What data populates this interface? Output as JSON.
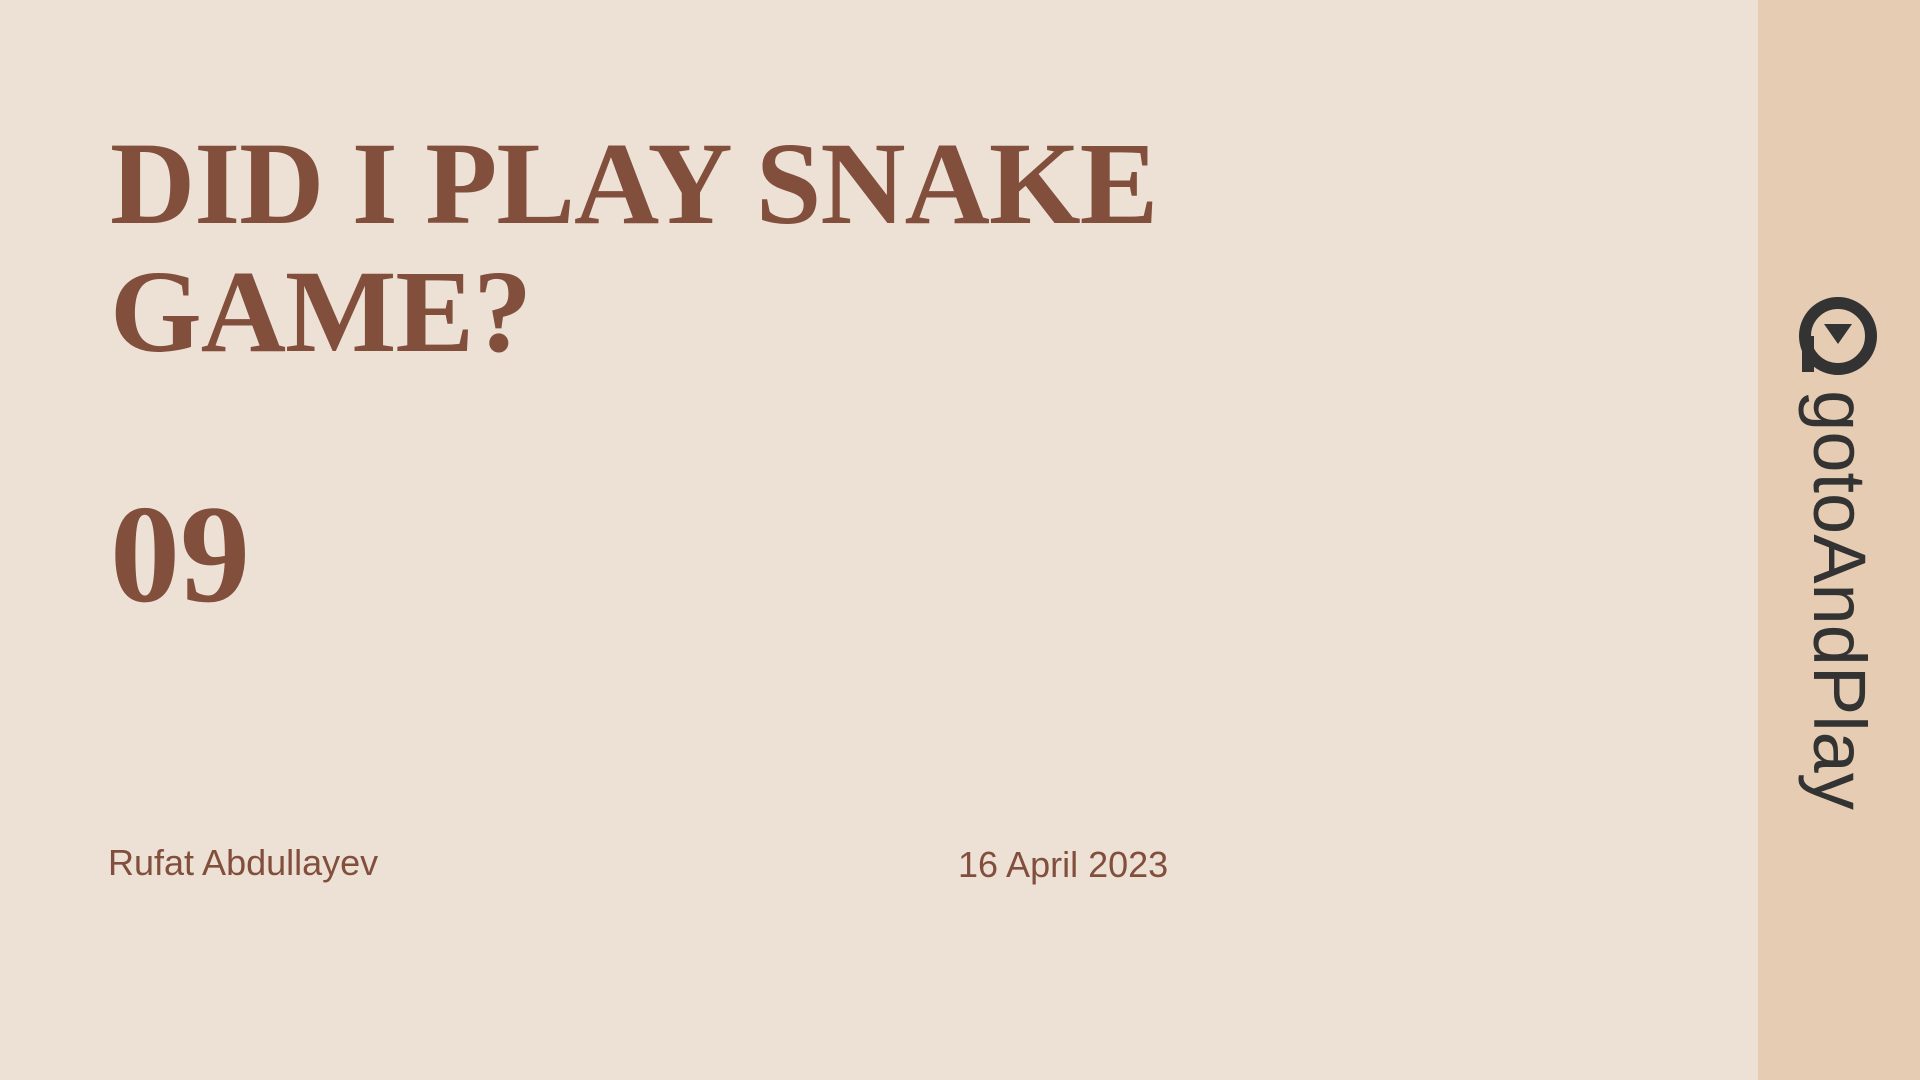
{
  "slide": {
    "title": "DID I PLAY SNAKE GAME?",
    "number": "09",
    "author": "Rufat Abdullayev",
    "date": "16 April 2023"
  },
  "sidebar": {
    "brand": "gotoAndPlay",
    "logo_icon": "play-circle-icon"
  },
  "colors": {
    "background": "#EDE1D6",
    "sidebar": "#E5CCB2",
    "accent": "#824F3D",
    "logo": "#333333"
  }
}
